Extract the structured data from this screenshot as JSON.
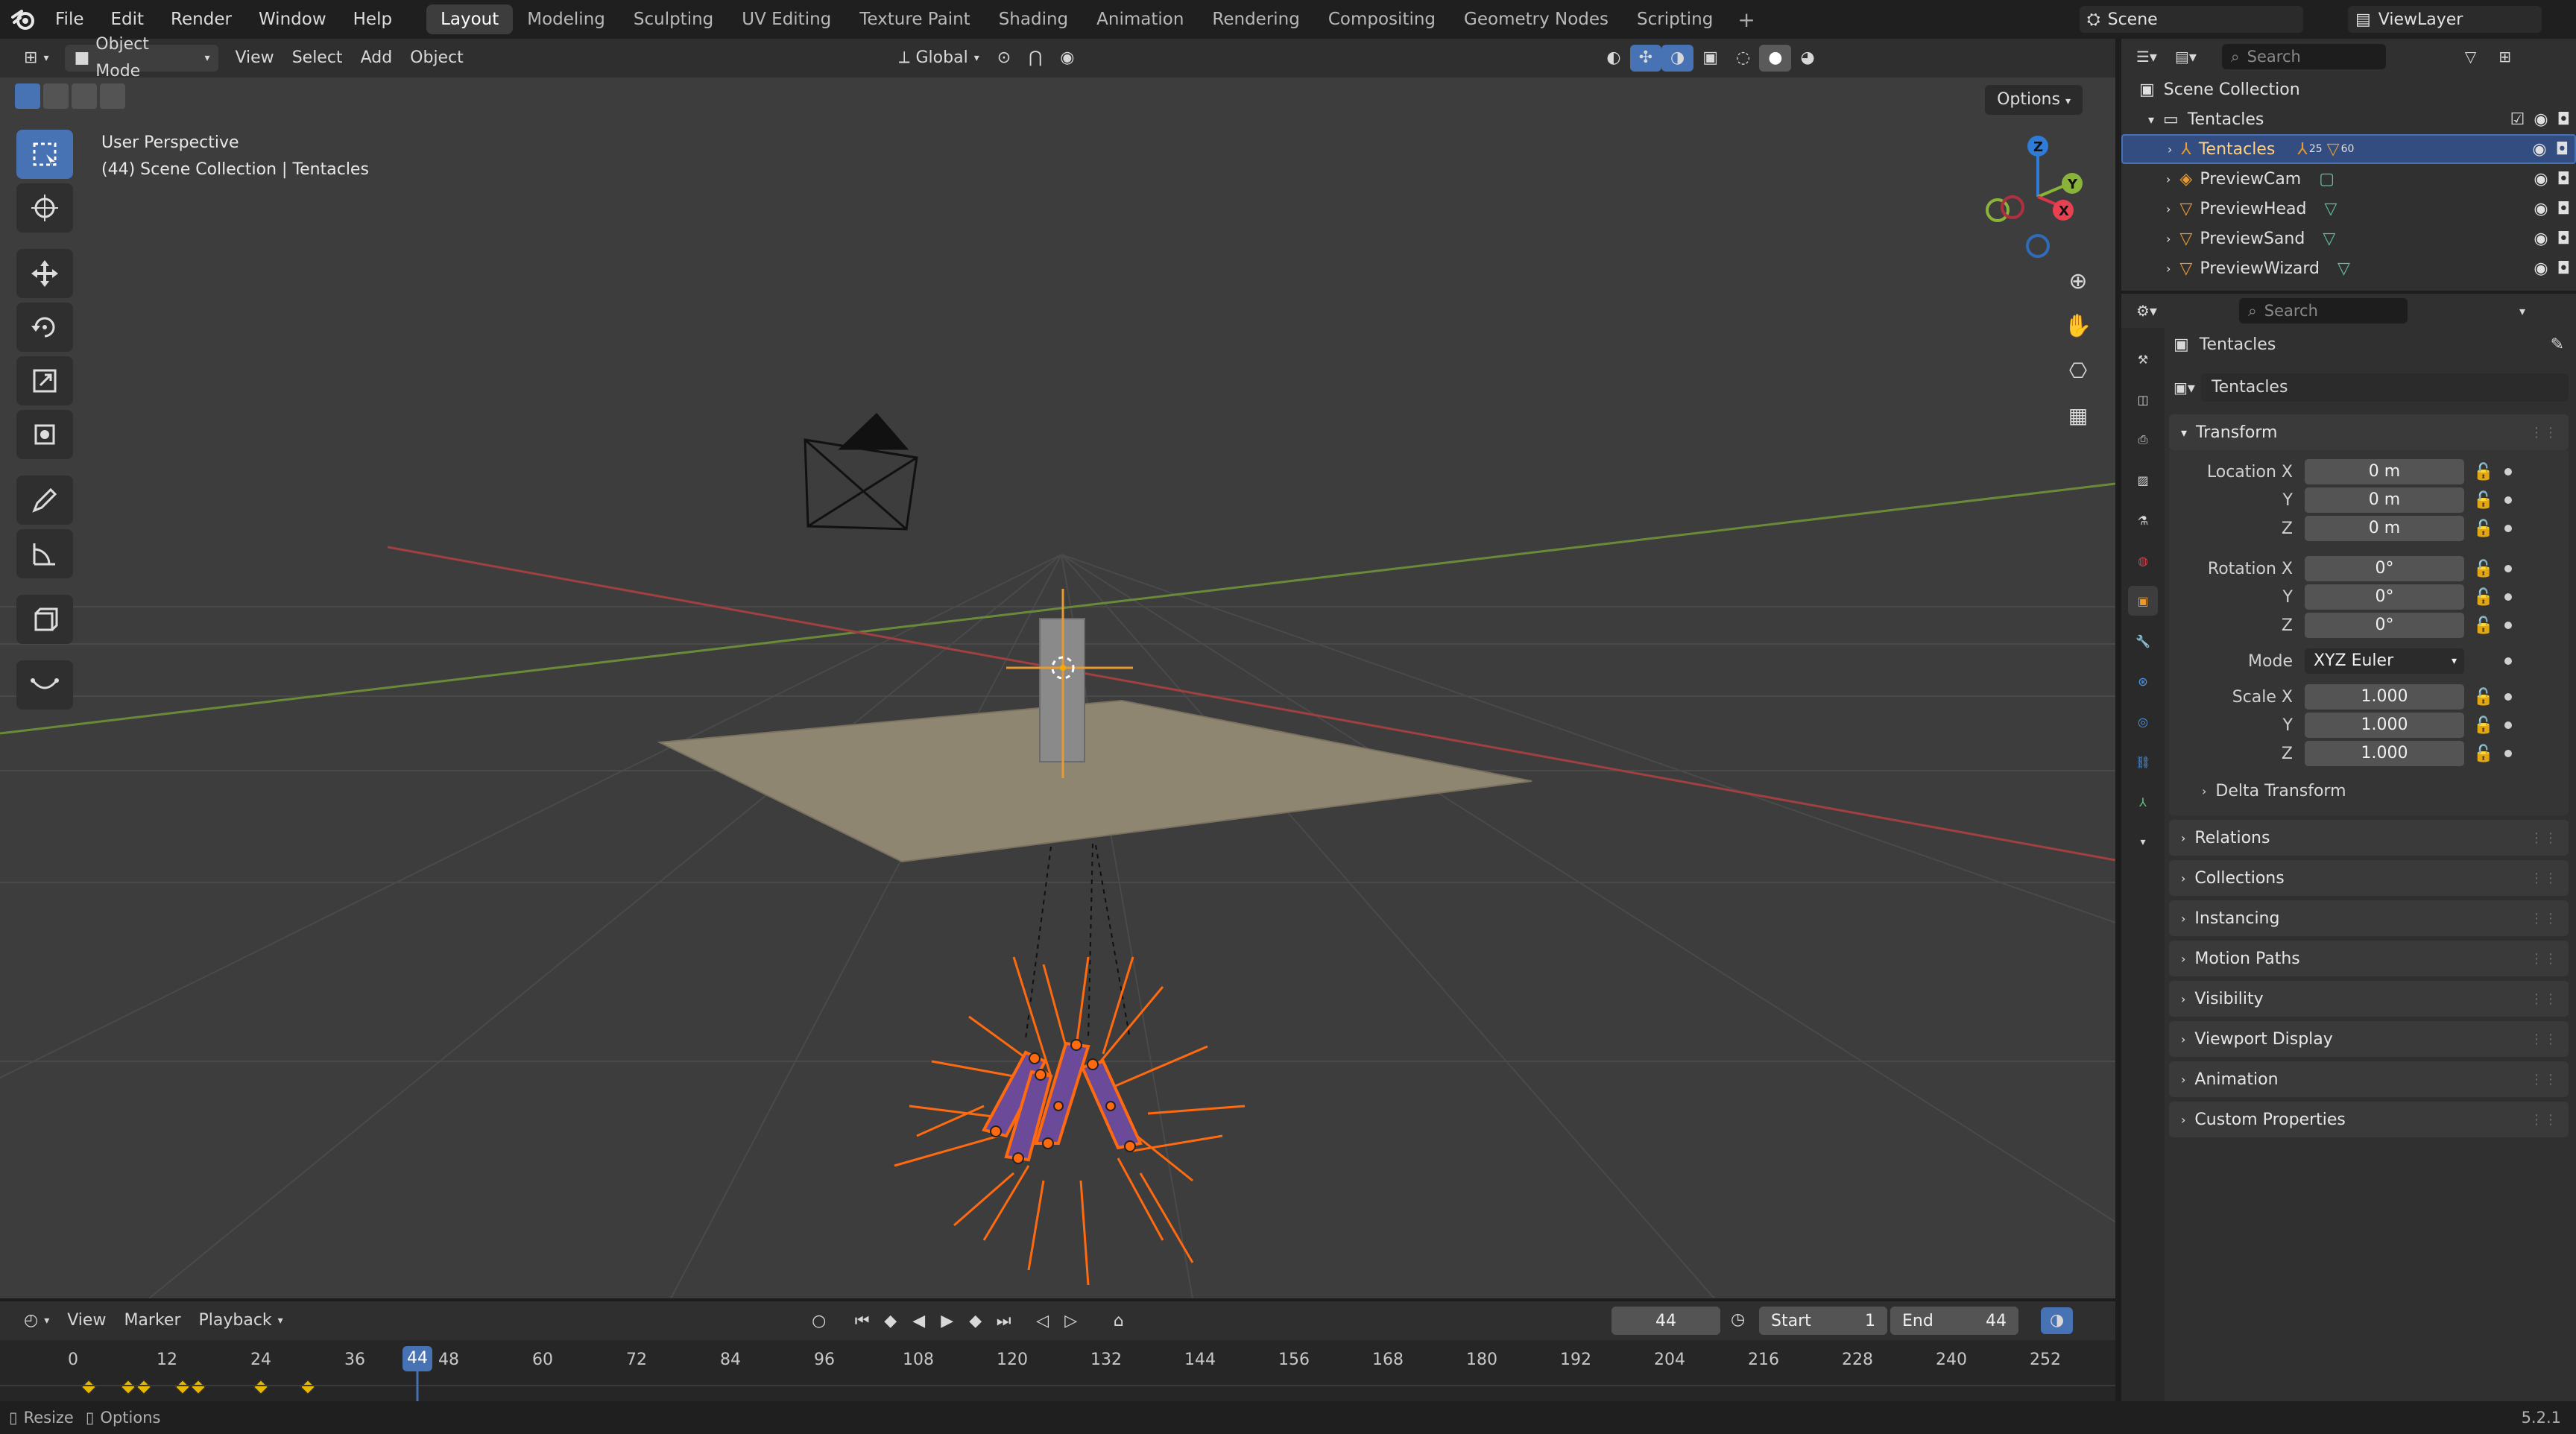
{
  "topbar": {
    "menus": [
      "File",
      "Edit",
      "Render",
      "Window",
      "Help"
    ],
    "workspaces": [
      "Layout",
      "Modeling",
      "Sculpting",
      "UV Editing",
      "Texture Paint",
      "Shading",
      "Animation",
      "Rendering",
      "Compositing",
      "Geometry Nodes",
      "Scripting"
    ],
    "active_workspace": "Layout",
    "scene": "Scene",
    "view_layer": "ViewLayer"
  },
  "viewport_header": {
    "mode": "Object Mode",
    "menus": [
      "View",
      "Select",
      "Add",
      "Object"
    ],
    "orientation": "Global"
  },
  "viewport": {
    "options_label": "Options",
    "info_line1": "User Perspective",
    "info_line2": "(44) Scene Collection | Tentacles",
    "tools": [
      "select-box",
      "cursor",
      "move",
      "rotate",
      "scale",
      "transform",
      "annotate",
      "measure",
      "add-cube",
      "shear"
    ]
  },
  "outliner": {
    "search_placeholder": "Search",
    "root": "Scene Collection",
    "collection": "Tentacles",
    "items": [
      {
        "name": "Tentacles",
        "selected": true
      },
      {
        "name": "PreviewCam",
        "selected": false
      },
      {
        "name": "PreviewHead",
        "selected": false
      },
      {
        "name": "PreviewSand",
        "selected": false
      },
      {
        "name": "PreviewWizard",
        "selected": false
      }
    ],
    "armature_count_a": "25",
    "armature_count_b": "60"
  },
  "properties": {
    "search_placeholder": "Search",
    "object_name": "Tentacles",
    "datablock_name": "Tentacles",
    "transform_label": "Transform",
    "location": {
      "label": "Location X",
      "x": "0 m",
      "y": "0 m",
      "z": "0 m"
    },
    "rotation": {
      "label": "Rotation X",
      "x": "0°",
      "y": "0°",
      "z": "0°"
    },
    "mode_label": "Mode",
    "mode_value": "XYZ Euler",
    "scale": {
      "label": "Scale X",
      "x": "1.000",
      "y": "1.000",
      "z": "1.000"
    },
    "axis_y": "Y",
    "axis_z": "Z",
    "delta_transform": "Delta Transform",
    "panels": [
      "Relations",
      "Collections",
      "Instancing",
      "Motion Paths",
      "Visibility",
      "Viewport Display",
      "Animation",
      "Custom Properties"
    ]
  },
  "timeline": {
    "menus": [
      "View",
      "Marker",
      "Playback"
    ],
    "current_frame": "44",
    "start_label": "Start",
    "start_value": "1",
    "end_label": "End",
    "end_value": "44",
    "ticks": [
      "0",
      "12",
      "24",
      "36",
      "48",
      "60",
      "72",
      "84",
      "96",
      "108",
      "120",
      "132",
      "144",
      "156",
      "168",
      "180",
      "192",
      "204",
      "216",
      "228",
      "240",
      "252"
    ],
    "keyframes": [
      2,
      7,
      9,
      14,
      16,
      24,
      30
    ]
  },
  "statusbar": {
    "resize": "Resize",
    "options": "Options",
    "version": "5.2.1"
  }
}
